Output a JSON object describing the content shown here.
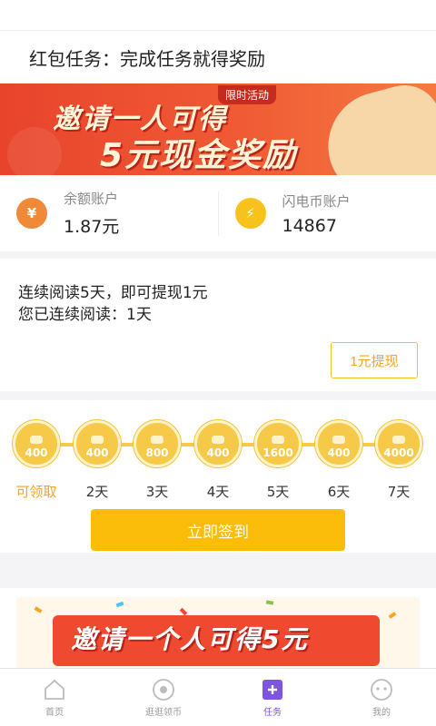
{
  "header": {
    "title": "红包任务：完成任务就得奖励"
  },
  "banner_top": {
    "tag": "限时活动",
    "line1": "邀请一人可得",
    "line2": "5元现金奖励"
  },
  "accounts": [
    {
      "label": "余额账户",
      "value": "1.87元",
      "icon": "yuan-coin-icon",
      "color": "#f08a38"
    },
    {
      "label": "闪电币账户",
      "value": "14867",
      "icon": "lightning-coin-icon",
      "color": "#f7c219"
    }
  ],
  "reading": {
    "line1": "连续阅读5天，即可提现1元",
    "line2": "您已连续阅读：1天",
    "withdraw_label": "1元提现"
  },
  "signin": {
    "days": [
      {
        "reward": "400",
        "label": "可领取"
      },
      {
        "reward": "400",
        "label": "2天"
      },
      {
        "reward": "800",
        "label": "3天"
      },
      {
        "reward": "400",
        "label": "4天"
      },
      {
        "reward": "1600",
        "label": "5天"
      },
      {
        "reward": "400",
        "label": "6天"
      },
      {
        "reward": "4000",
        "label": "7天"
      }
    ],
    "button_label": "立即签到"
  },
  "banner_bottom": {
    "text": "邀请一个人可得5元"
  },
  "tabs": [
    {
      "label": "首页",
      "icon": "home-icon"
    },
    {
      "label": "逛逛领币",
      "icon": "eye-icon"
    },
    {
      "label": "任务",
      "icon": "task-icon"
    },
    {
      "label": "我的",
      "icon": "profile-icon"
    }
  ],
  "colors": {
    "accent": "#fbbd0a",
    "active_tab": "#7d55e0",
    "active_day": "#f5a623"
  }
}
